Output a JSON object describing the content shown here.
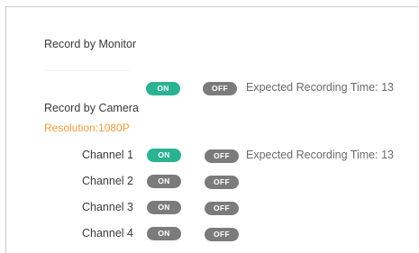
{
  "colors": {
    "on_active": "#2ab392",
    "toggle_grey": "#7b7b7b",
    "resolution_orange": "#f59a3c",
    "text": "#3a3a3a"
  },
  "monitor": {
    "title": "Record by Monitor",
    "on_label": "ON",
    "off_label": "OFF",
    "state": "on",
    "expected_time": "Expected Recording Time: 13"
  },
  "camera": {
    "title": "Record by Camera",
    "resolution": "Resolution:1080P",
    "channels": [
      {
        "label": "Channel 1",
        "on_label": "ON",
        "off_label": "OFF",
        "state": "on",
        "expected_time": "Expected Recording Time: 13"
      },
      {
        "label": "Channel 2",
        "on_label": "ON",
        "off_label": "OFF",
        "state": "off"
      },
      {
        "label": "Channel 3",
        "on_label": "ON",
        "off_label": "OFF",
        "state": "off"
      },
      {
        "label": "Channel 4",
        "on_label": "ON",
        "off_label": "OFF",
        "state": "off"
      }
    ]
  }
}
